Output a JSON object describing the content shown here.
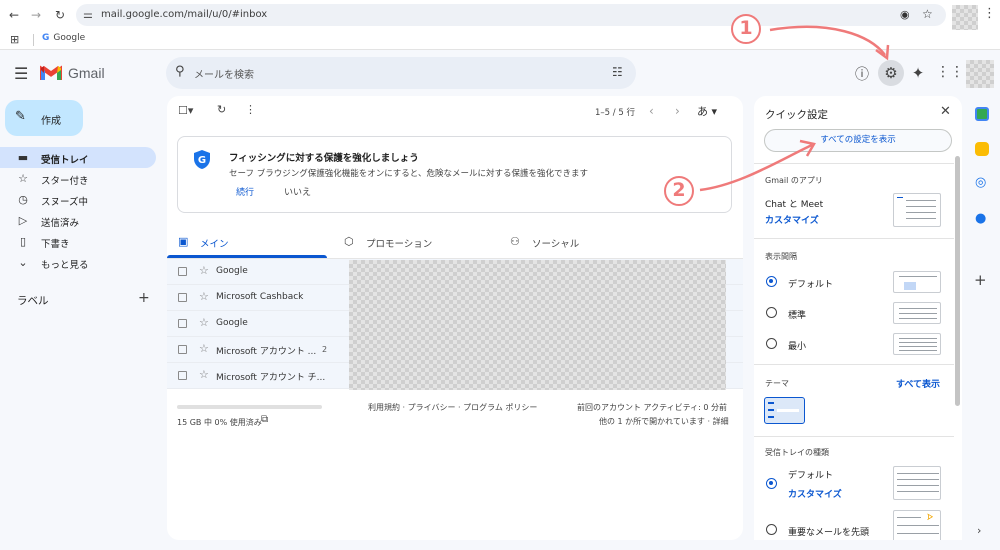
{
  "browser": {
    "url": "mail.google.com/mail/u/0/#inbox",
    "bookmark_google": "Google"
  },
  "header": {
    "app_name": "Gmail",
    "search_placeholder": "メールを検索"
  },
  "nav": {
    "compose": "作成",
    "items": [
      {
        "label": "受信トレイ",
        "icon": "inbox-icon",
        "glyph": "▬"
      },
      {
        "label": "スター付き",
        "icon": "star-icon",
        "glyph": "☆"
      },
      {
        "label": "スヌーズ中",
        "icon": "clock-icon",
        "glyph": "◷"
      },
      {
        "label": "送信済み",
        "icon": "send-icon",
        "glyph": "▷"
      },
      {
        "label": "下書き",
        "icon": "draft-icon",
        "glyph": "▯"
      },
      {
        "label": "もっと見る",
        "icon": "chevron-down-icon",
        "glyph": "⌄"
      }
    ],
    "labels_heading": "ラベル"
  },
  "toolbar": {
    "pagination": "1–5 / 5 行",
    "input_tool": "あ"
  },
  "banner": {
    "title": "フィッシングに対する保護を強化しましょう",
    "description": "セーフ ブラウジング保護強化機能をオンにすると、危険なメールに対する保護を強化できます",
    "action_primary": "続行",
    "action_secondary": "いいえ"
  },
  "tabs": [
    {
      "label": "メイン",
      "icon": "inbox-icon"
    },
    {
      "label": "プロモーション",
      "icon": "tag-icon"
    },
    {
      "label": "ソーシャル",
      "icon": "people-icon"
    }
  ],
  "emails": [
    {
      "sender": "Google",
      "count": ""
    },
    {
      "sender": "Microsoft Cashback",
      "count": ""
    },
    {
      "sender": "Google",
      "count": ""
    },
    {
      "sender": "Microsoft アカウント ...",
      "count": "2"
    },
    {
      "sender": "Microsoft アカウント チ...",
      "count": ""
    }
  ],
  "footer": {
    "storage_used": 0,
    "storage": "15 GB 中 0% 使用済み",
    "terms": "利用規約 · プライバシー · プログラム ポリシー",
    "activity_line1": "前回のアカウント アクティビティ: 0 分前",
    "activity_line2": "他の 1 か所で開かれています · 詳細"
  },
  "quick_settings": {
    "title": "クイック設定",
    "all_settings": "すべての設定を表示",
    "apps_heading": "Gmail のアプリ",
    "chat_meet": "Chat と Meet",
    "customize": "カスタマイズ",
    "density_heading": "表示間隔",
    "density_options": [
      "デフォルト",
      "標準",
      "最小"
    ],
    "density_selected": "デフォルト",
    "theme_heading": "テーマ",
    "theme_view_all": "すべて表示",
    "inbox_type_heading": "受信トレイの種類",
    "inbox_default": "デフォルト",
    "inbox_customize": "カスタマイズ",
    "inbox_important": "重要なメールを先頭"
  },
  "annotations": {
    "step1": "1",
    "step2": "2",
    "color": "#ef7a7a"
  },
  "colors": {
    "accent": "#0b57d0",
    "compose_bg": "#c2e7ff",
    "active_nav": "#d3e3fd"
  }
}
